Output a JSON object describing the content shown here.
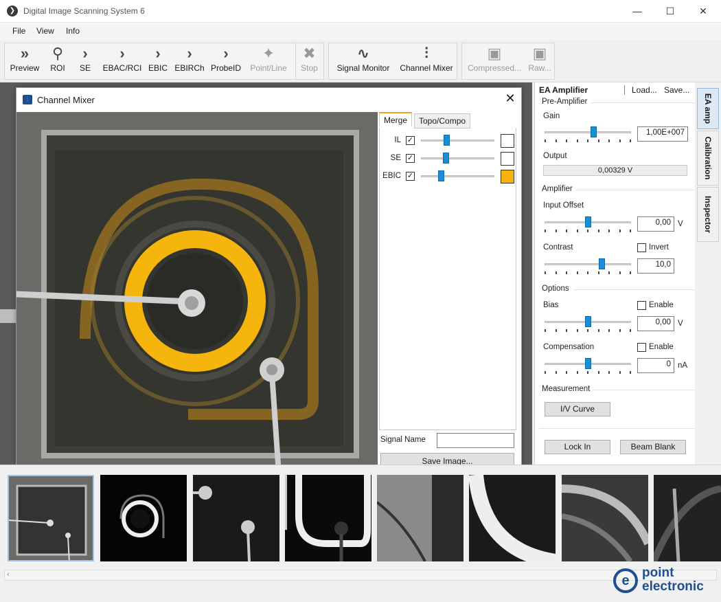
{
  "window": {
    "title": "Digital Image Scanning System 6",
    "controls": [
      "—",
      "☐",
      "✕"
    ]
  },
  "menu": {
    "items": [
      "File",
      "View",
      "Info"
    ]
  },
  "toolbar": {
    "buttons": [
      {
        "label": "Preview",
        "icon": "double-chevron-icon"
      },
      {
        "label": "ROI",
        "icon": "search-icon"
      },
      {
        "label": "SE",
        "icon": "chevron-icon"
      },
      {
        "label": "EBAC/RCI",
        "icon": "chevron-icon"
      },
      {
        "label": "EBIC",
        "icon": "chevron-icon"
      },
      {
        "label": "EBIRCh",
        "icon": "chevron-icon"
      },
      {
        "label": "ProbeID",
        "icon": "chevron-icon"
      },
      {
        "label": "Point/Line",
        "icon": "sparkle-icon"
      },
      {
        "label": "Stop",
        "icon": "stop-x-icon"
      },
      {
        "label": "Signal Monitor",
        "icon": "waveform-icon"
      },
      {
        "label": "Channel Mixer",
        "icon": "sliders-icon"
      },
      {
        "label": "Compressed...",
        "icon": "floppy-icon"
      },
      {
        "label": "Raw...",
        "icon": "floppy-icon"
      }
    ]
  },
  "mixer": {
    "title": "Channel Mixer",
    "tabs": [
      "Merge",
      "Topo/Compo"
    ],
    "channels": [
      {
        "label": "IL",
        "checked": "✓",
        "level": 0.35,
        "color": "#ffffff"
      },
      {
        "label": "SE",
        "checked": "✓",
        "level": 0.34,
        "color": "#ffffff"
      },
      {
        "label": "EBIC",
        "checked": "✓",
        "level": 0.27,
        "color": "#f5b50c"
      }
    ],
    "signal_name_label": "Signal Name",
    "signal_name_value": "",
    "save_button": "Save Image..."
  },
  "panel": {
    "title": "EA Amplifier",
    "load": "Load...",
    "save": "Save...",
    "preamp": {
      "section": "Pre-Amplifier",
      "gain_label": "Gain",
      "gain_value": "1,00E+007",
      "gain_level": 0.56,
      "output_label": "Output",
      "output_value": "0,00329 V"
    },
    "amplifier": {
      "section": "Amplifier",
      "offset_label": "Input Offset",
      "offset_value": "0,00",
      "offset_unit": "V",
      "offset_level": 0.5,
      "contrast_label": "Contrast",
      "contrast_value": "10,0",
      "contrast_level": 0.66,
      "invert_label": "Invert"
    },
    "options": {
      "section": "Options",
      "bias_label": "Bias",
      "bias_value": "0,00",
      "bias_unit": "V",
      "bias_level": 0.5,
      "bias_enable": "Enable",
      "comp_label": "Compensation",
      "comp_value": "0",
      "comp_unit": "nA",
      "comp_level": 0.5,
      "comp_enable": "Enable"
    },
    "measurement": {
      "section": "Measurement",
      "iv_button": "I/V Curve"
    },
    "lockin_button": "Lock In",
    "beamblank_button": "Beam Blank"
  },
  "side_tabs": [
    "EA amp",
    "Calibration",
    "Inspector"
  ],
  "brand": {
    "line1": "point",
    "line2": "electronic",
    "color": "#1d4f91"
  }
}
